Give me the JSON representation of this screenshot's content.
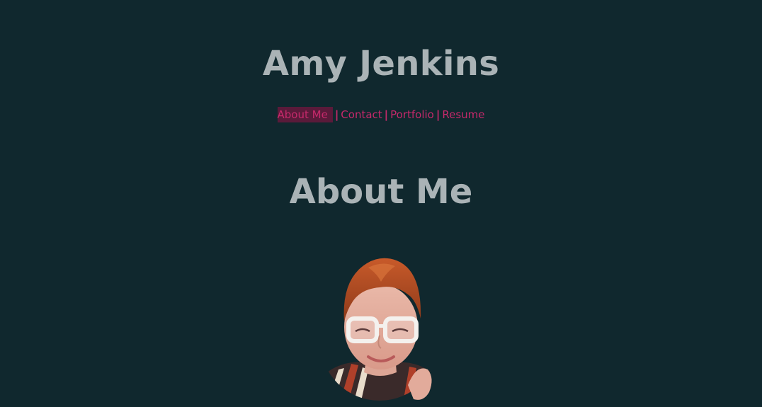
{
  "header": {
    "title": "Amy Jenkins"
  },
  "nav": {
    "items": [
      {
        "label": "About Me"
      },
      {
        "label": "Contact"
      },
      {
        "label": "Portfolio"
      },
      {
        "label": "Resume"
      }
    ],
    "separator": "|",
    "active_index": 0
  },
  "main": {
    "heading": "About Me"
  },
  "colors": {
    "background": "#10282e",
    "heading": "#aab3b6",
    "link": "#c6296b",
    "active_highlight": "#5a1a3a"
  }
}
